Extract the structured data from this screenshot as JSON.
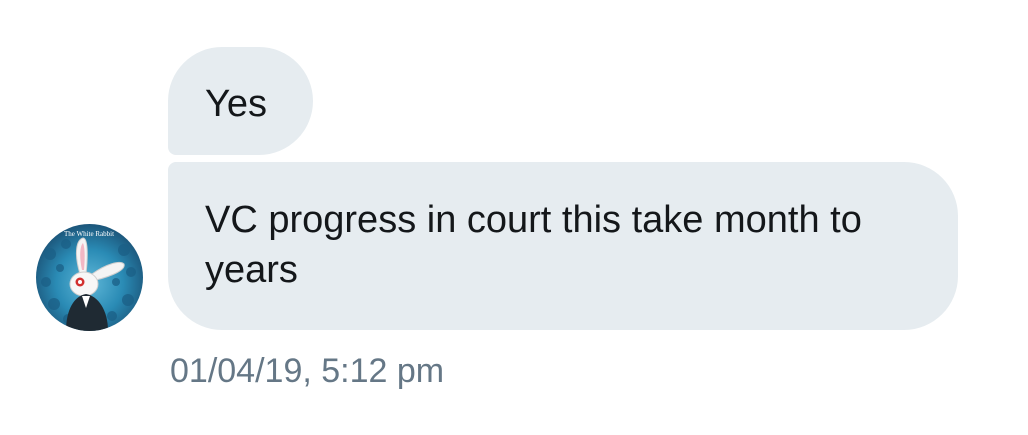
{
  "conversation": {
    "messages": [
      {
        "text": "Yes"
      },
      {
        "text": "VC progress in court this take month to years"
      }
    ],
    "timestamp": "01/04/19, 5:12 pm",
    "avatar": {
      "icon": "white-rabbit-avatar-icon",
      "caption": "The White Rabbit"
    }
  },
  "colors": {
    "bubble": "#e6ecf0",
    "message_text": "#14171a",
    "timestamp_text": "#657786",
    "background": "#ffffff"
  }
}
